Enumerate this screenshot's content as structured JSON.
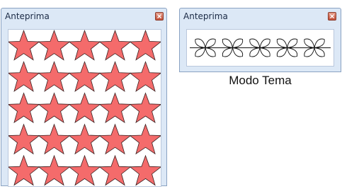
{
  "panels": [
    {
      "title": "Anteprima",
      "close_icon": "close-icon",
      "pattern": "stars",
      "pattern_rows": 5,
      "pattern_cols": 5,
      "star_color": "#f46b6b"
    },
    {
      "title": "Anteprima",
      "close_icon": "close-icon",
      "pattern": "flowers-on-line",
      "pattern_cols": 5
    }
  ],
  "caption": "Modo Tema",
  "colors": {
    "panel_bg": "#dce8f6",
    "panel_border": "#8aa2c2",
    "close_button": "#c2503a",
    "star_fill": "#f46b6b"
  }
}
